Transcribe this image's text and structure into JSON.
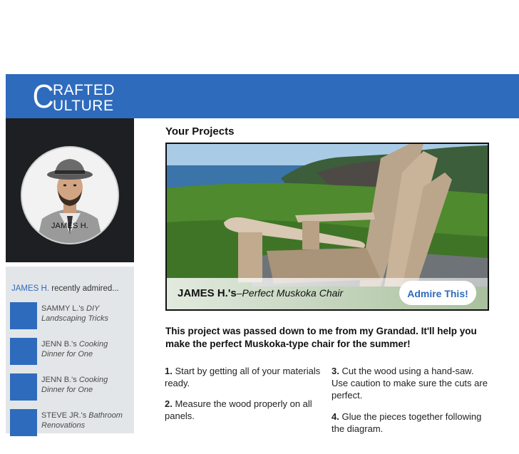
{
  "brand": {
    "line1": "RAFTED",
    "line2": "ULTURE",
    "initial1": "C",
    "initial2": "C",
    "color": "#2e6bbd"
  },
  "profile": {
    "name": "JAMES H."
  },
  "admired": {
    "who": "JAMES H.",
    "suffix": " recently admired...",
    "items": [
      {
        "author": "SAMMY L.'s ",
        "title": "DIY",
        "title2": "Landscaping Tricks"
      },
      {
        "author": "JENN B.'s ",
        "title": "Cooking",
        "title2": "Dinner for One"
      },
      {
        "author": "JENN B.'s ",
        "title": "Cooking",
        "title2": "Dinner for One"
      },
      {
        "author": "STEVE JR.'s ",
        "title": "Bathroom",
        "title2": "Renovations"
      }
    ]
  },
  "projects": {
    "heading": "Your Projects",
    "caption_author": "JAMES H.'s",
    "caption_title": "–Perfect Muskoka Chair",
    "admire_label": "Admire This!"
  },
  "description": {
    "lead": "This project was passed down to me from my Grandad. It'll help you make the perfect Muskoka-type chair for the summer!",
    "steps": [
      {
        "num": "1.",
        "text": " Start by getting all of your materials ready."
      },
      {
        "num": "2.",
        "text": " Measure the wood properly on all panels."
      },
      {
        "num": "3.",
        "text": " Cut the wood using a hand-saw. Use caution to make sure the cuts are perfect."
      },
      {
        "num": "4.",
        "text": " Glue the pieces together following the diagram."
      }
    ]
  }
}
